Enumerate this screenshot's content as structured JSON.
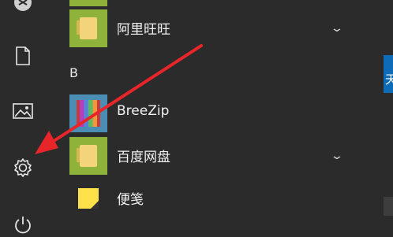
{
  "start_menu": {
    "section_b": "B",
    "apps": [
      {
        "name": "阿里旺旺",
        "tile_color": "#8fb33a",
        "icon": "folder-icon",
        "has_chevron": true
      },
      {
        "name": "BreeZip",
        "tile_color": "#4a8db5",
        "icon": "breezip-icon",
        "has_chevron": false
      },
      {
        "name": "百度网盘",
        "tile_color": "#8fb33a",
        "icon": "folder-icon",
        "has_chevron": true
      },
      {
        "name": "便笺",
        "tile_color": "#f3c313",
        "icon": "sticky-note-icon",
        "has_chevron": false
      }
    ],
    "chevron_glyph": "⌄",
    "right_tile_partial_text": "天"
  },
  "rail": {
    "icons": [
      "user-avatar-icon",
      "document-icon",
      "pictures-icon",
      "settings-gear-icon",
      "power-icon"
    ]
  },
  "annotation": {
    "arrow_color": "#e8262a"
  }
}
